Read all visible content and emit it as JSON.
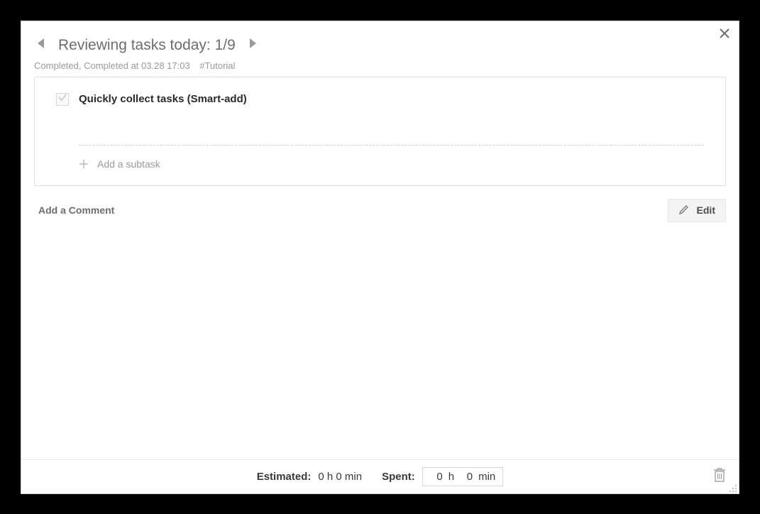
{
  "header": {
    "title_prefix": "Reviewing tasks today:",
    "index": "1/9"
  },
  "meta": {
    "status_text": "Completed, Completed at 03.28 17:03",
    "tag": "#Tutorial"
  },
  "task": {
    "title": "Quickly collect tasks (Smart-add)",
    "completed": true,
    "add_subtask_label": "Add a subtask"
  },
  "actions": {
    "add_comment_label": "Add a Comment",
    "edit_label": "Edit"
  },
  "footer": {
    "estimated_label": "Estimated:",
    "estimated_value": "0 h 0 min",
    "spent_label": "Spent:",
    "spent_hours": "0",
    "spent_hours_unit": "h",
    "spent_minutes": "0",
    "spent_minutes_unit": "min"
  }
}
